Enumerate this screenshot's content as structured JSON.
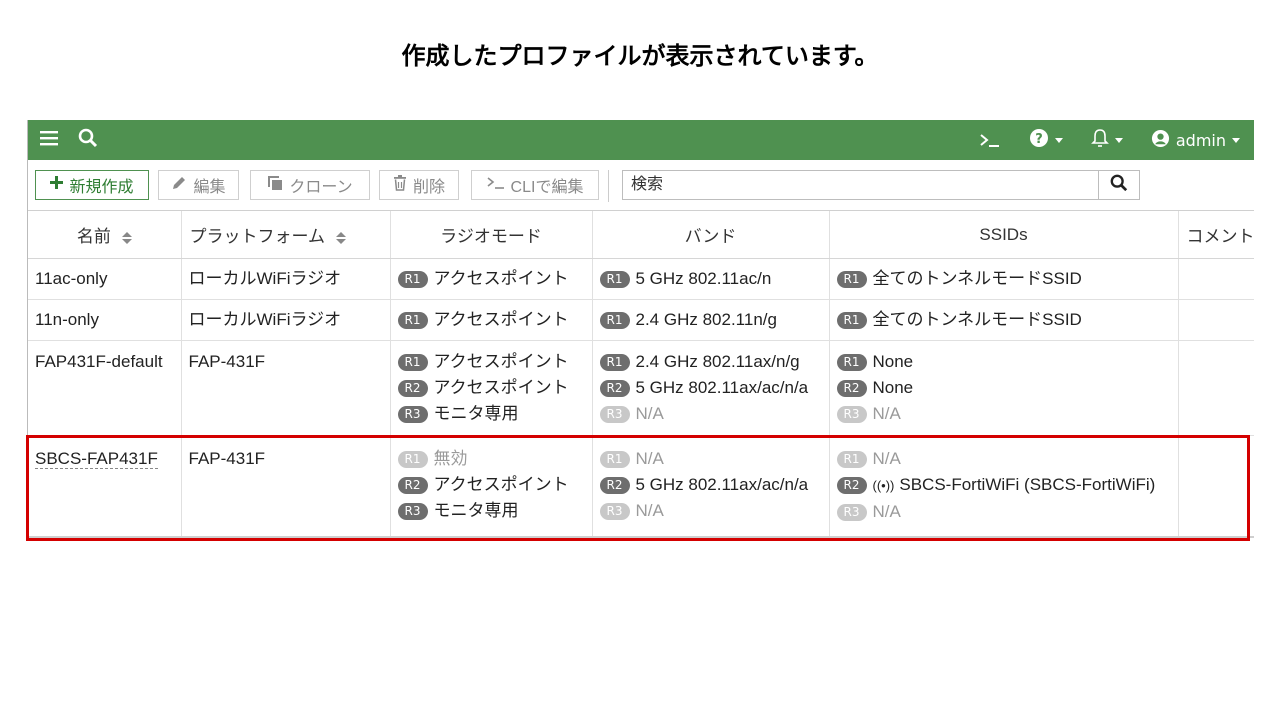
{
  "slide": {
    "title": "作成したプロファイルが表示されています。"
  },
  "topbar": {
    "user": "admin"
  },
  "toolbar": {
    "new_label": "新規作成",
    "edit_label": "編集",
    "clone_label": "クローン",
    "delete_label": "削除",
    "cli_label": "CLIで編集",
    "search_placeholder": "検索"
  },
  "table": {
    "headers": {
      "name": "名前",
      "platform": "プラットフォーム",
      "radio_mode": "ラジオモード",
      "band": "バンド",
      "ssids": "SSIDs",
      "comment": "コメント"
    },
    "rows": [
      {
        "name": "11ac-only",
        "platform": "ローカルWiFiラジオ",
        "modes": [
          {
            "badge": "R1",
            "text": "アクセスポイント"
          }
        ],
        "bands": [
          {
            "badge": "R1",
            "text": "5 GHz 802.11ac/n"
          }
        ],
        "ssids": [
          {
            "badge": "R1",
            "text": "全てのトンネルモードSSID"
          }
        ]
      },
      {
        "name": "11n-only",
        "platform": "ローカルWiFiラジオ",
        "modes": [
          {
            "badge": "R1",
            "text": "アクセスポイント"
          }
        ],
        "bands": [
          {
            "badge": "R1",
            "text": "2.4 GHz 802.11n/g"
          }
        ],
        "ssids": [
          {
            "badge": "R1",
            "text": "全てのトンネルモードSSID"
          }
        ]
      },
      {
        "name": "FAP431F-default",
        "platform": "FAP-431F",
        "modes": [
          {
            "badge": "R1",
            "text": "アクセスポイント"
          },
          {
            "badge": "R2",
            "text": "アクセスポイント"
          },
          {
            "badge": "R3",
            "text": "モニタ専用"
          }
        ],
        "bands": [
          {
            "badge": "R1",
            "text": "2.4 GHz 802.11ax/n/g"
          },
          {
            "badge": "R2",
            "text": "5 GHz 802.11ax/ac/n/a"
          },
          {
            "badge": "R3",
            "text": "N/A"
          }
        ],
        "ssids": [
          {
            "badge": "R1",
            "text": "None"
          },
          {
            "badge": "R2",
            "text": "None"
          },
          {
            "badge": "R3",
            "text": "N/A"
          }
        ]
      },
      {
        "name": "SBCS-FAP431F",
        "platform": "FAP-431F",
        "modes": [
          {
            "badge": "R1",
            "text": "無効"
          },
          {
            "badge": "R2",
            "text": "アクセスポイント"
          },
          {
            "badge": "R3",
            "text": "モニタ専用"
          }
        ],
        "bands": [
          {
            "badge": "R1",
            "text": "N/A"
          },
          {
            "badge": "R2",
            "text": "5 GHz 802.11ax/ac/n/a"
          },
          {
            "badge": "R3",
            "text": "N/A"
          }
        ],
        "ssids": [
          {
            "badge": "R1",
            "text": "N/A"
          },
          {
            "badge": "R2",
            "text": "SBCS-FortiWiFi (SBCS-FortiWiFi)"
          },
          {
            "badge": "R3",
            "text": "N/A"
          }
        ]
      }
    ]
  },
  "colors": {
    "header_green": "#4f9150",
    "highlight_red": "#d40000",
    "badge_gray": "#6e6e6e",
    "badge_dim": "#c8c8c8"
  }
}
